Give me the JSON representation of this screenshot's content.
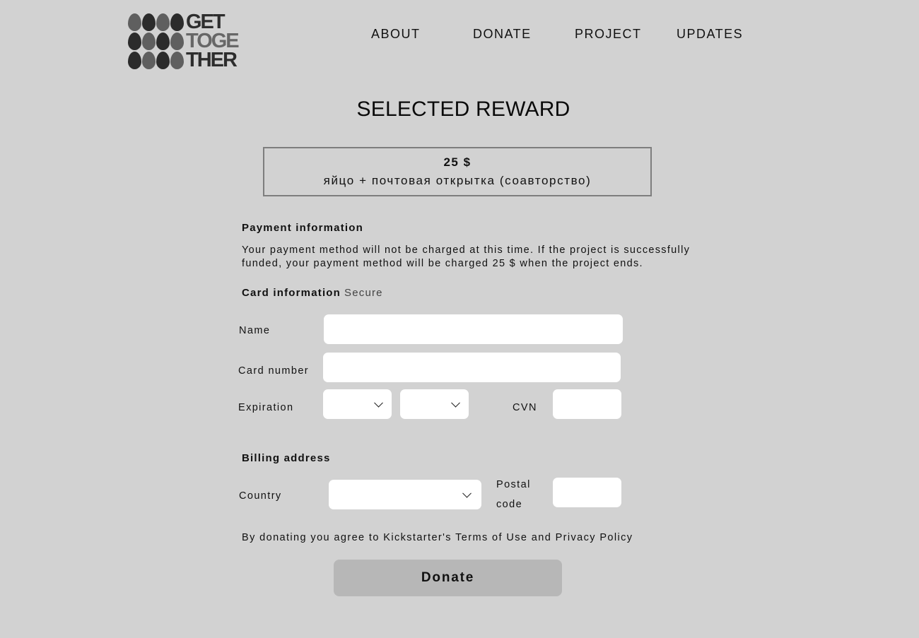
{
  "logo": {
    "lines": [
      "GET",
      "TOGE",
      "THER"
    ]
  },
  "nav": {
    "items": [
      {
        "label": "ABOUT"
      },
      {
        "label": "DONATE"
      },
      {
        "label": "PROJECT"
      },
      {
        "label": "UPDATES"
      }
    ]
  },
  "page": {
    "title": "SELECTED REWARD"
  },
  "reward": {
    "price": "25 $",
    "description": "яйцо + почтовая открытка (соавторство)"
  },
  "payment": {
    "title": "Payment information",
    "notice": "Your payment method will not be charged at this time. If the project is successfully funded, your payment method will be charged 25 $ when the project ends."
  },
  "card": {
    "title": "Card information",
    "secure": "Secure",
    "name_label": "Name",
    "name_value": "",
    "number_label": "Card number",
    "number_value": "",
    "expiration_label": "Expiration",
    "cvn_label": "CVN",
    "cvn_value": ""
  },
  "billing": {
    "title": "Billing address",
    "country_label": "Country",
    "postal_label_1": "Postal",
    "postal_label_2": "code",
    "postal_value": ""
  },
  "terms": {
    "text": "By donating you agree to Kickstarter's Terms of Use and Privacy Policy"
  },
  "actions": {
    "donate_label": "Donate"
  },
  "icons": {
    "select_chevron": "chevron-down-icon"
  },
  "colors": {
    "background": "#d2d2d2",
    "field": "#ffffff",
    "button": "#b7b7b7",
    "egg_dark": "#2b2b2b",
    "egg_mid": "#5f5f5f"
  }
}
